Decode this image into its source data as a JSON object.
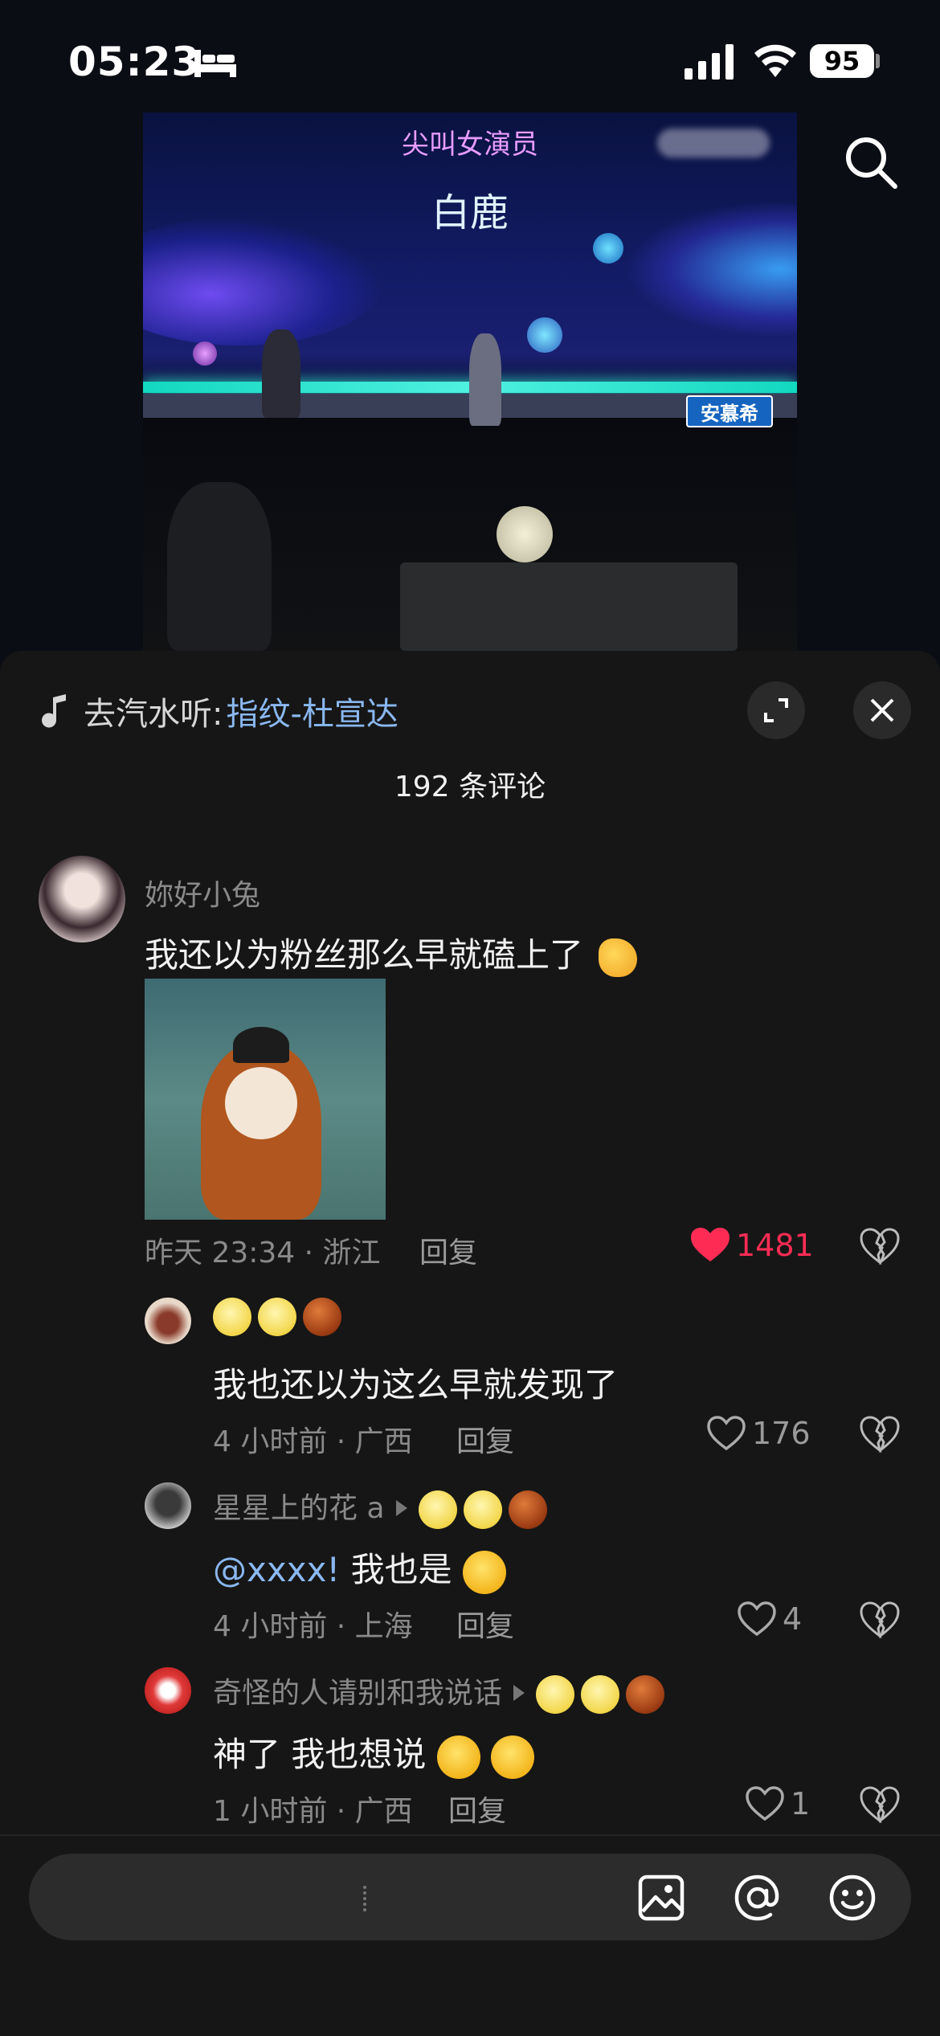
{
  "status": {
    "time": "05:23",
    "battery": "95"
  },
  "video": {
    "subtitle_top": "尖叫女演员",
    "subtitle_name": "白鹿",
    "logo": "安慕希"
  },
  "sheet": {
    "music_prefix": "去汽水听:",
    "music_link": "指纹-杜宣达",
    "comment_count": "192 条评论"
  },
  "comments": [
    {
      "username": "妳好小兔",
      "text": "我还以为粉丝那么早就磕上了",
      "meta": "昨天 23:34 · 浙江",
      "reply": "回复",
      "likes": "1481",
      "liked": true
    },
    {
      "username": "",
      "text": "我也还以为这么早就发现了",
      "meta": "4 小时前 · 广西",
      "reply": "回复",
      "likes": "176"
    },
    {
      "username": "星星上的花 a",
      "mention": "@xxxx!",
      "text": "我也是",
      "meta": "4 小时前 · 上海",
      "reply": "回复",
      "likes": "4"
    },
    {
      "username": "奇怪的人请别和我说话",
      "text": "神了 我也想说",
      "meta": "1 小时前 · 广西",
      "reply": "回复",
      "likes": "1"
    }
  ],
  "input": {
    "placeholder": ""
  },
  "colors": {
    "like_red": "#fe2c55",
    "link_blue": "#8ab8f0",
    "background": "#161616"
  },
  "icons": [
    "bed-icon",
    "signal-icon",
    "wifi-icon",
    "search-icon",
    "music-note-icon",
    "expand-icon",
    "close-icon",
    "heart-icon",
    "broken-heart-icon",
    "image-icon",
    "at-icon",
    "emoji-icon"
  ]
}
